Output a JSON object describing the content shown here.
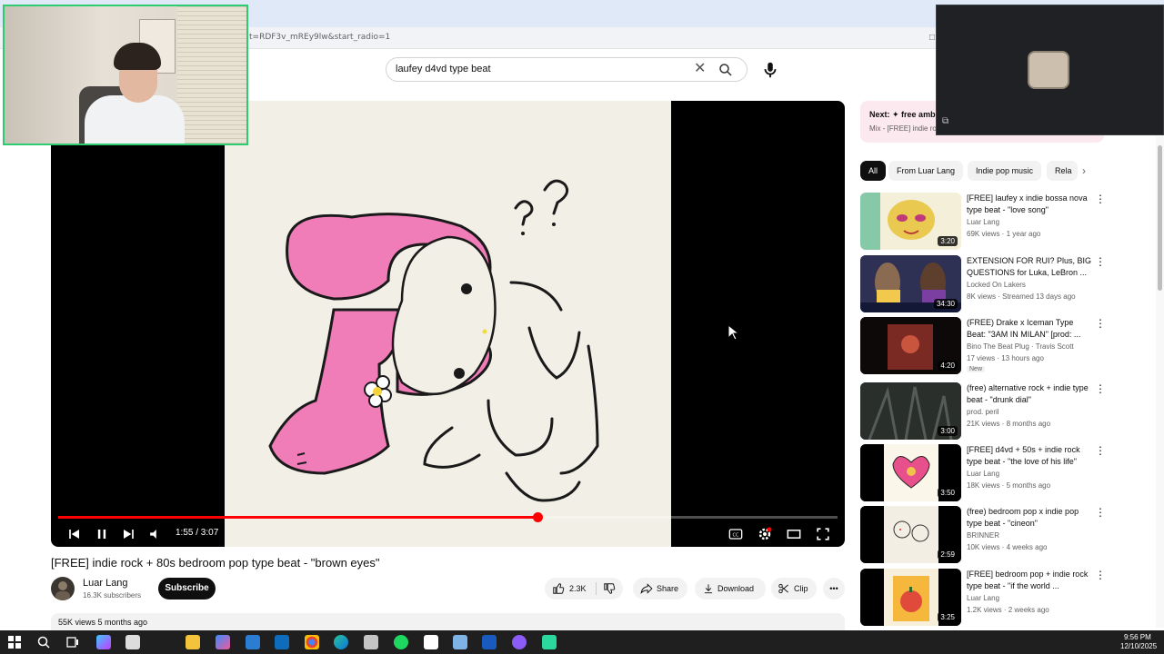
{
  "browser": {
    "url": "t=RDF3v_mREy9lw&start_radio=1"
  },
  "search": {
    "query": "laufey d4vd type beat"
  },
  "player": {
    "time": "1:55 / 3:07",
    "progress": 0.615,
    "colors": {
      "progress": "#ff0000",
      "background": "#000000"
    }
  },
  "video": {
    "title": "[FREE] indie rock + 80s bedroom pop type beat - \"brown eyes\"",
    "channel": "Luar Lang",
    "subscribers": "16.3K subscribers",
    "subscribe_label": "Subscribe",
    "likes": "2.3K",
    "share_label": "Share",
    "download_label": "Download",
    "clip_label": "Clip",
    "views_date": "55K views  5 months ago"
  },
  "next_up": {
    "label": "Next: ✦ free amb",
    "sub": "Mix - [FREE] indie ro"
  },
  "chips": [
    "All",
    "From Luar Lang",
    "Indie pop music",
    "Rela"
  ],
  "recommendations": [
    {
      "title": "[FREE] laufey x indie bossa nova type beat - \"love song\"",
      "channel": "Luar Lang",
      "meta": "69K views · 1 year ago",
      "duration": "3:20",
      "badge": ""
    },
    {
      "title": "EXTENSION FOR RUI? Plus, BIG QUESTIONS for Luka, LeBron ...",
      "channel": "Locked On Lakers",
      "meta": "8K views · Streamed 13 days ago",
      "duration": "34:30",
      "badge": ""
    },
    {
      "title": "(FREE) Drake x Iceman Type Beat: \"3AM IN MILAN\" [prod: ...",
      "channel": "Bino The Beat Plug · Travis Scott",
      "meta": "17 views · 13 hours ago",
      "duration": "4:20",
      "badge": "New"
    },
    {
      "title": "(free) alternative rock + indie type beat - \"drunk dial\"",
      "channel": "prod. peril",
      "meta": "21K views · 8 months ago",
      "duration": "3:00",
      "badge": ""
    },
    {
      "title": "[FREE] d4vd + 50s + indie rock type beat - \"the love of his life\"",
      "channel": "Luar Lang",
      "meta": "18K views · 5 months ago",
      "duration": "3:50",
      "badge": ""
    },
    {
      "title": "(free) bedroom pop x indie pop type beat - \"cineon\"",
      "channel": "BRINNER",
      "meta": "10K views · 4 weeks ago",
      "duration": "2:59",
      "badge": ""
    },
    {
      "title": "[FREE] bedroom pop + indie rock type beat - \"if the world ...",
      "channel": "Luar Lang",
      "meta": "1.2K views · 2 weeks ago",
      "duration": "3:25",
      "badge": ""
    }
  ],
  "taskbar": {
    "time": "9:56 PM",
    "date": "12/10/2025"
  }
}
